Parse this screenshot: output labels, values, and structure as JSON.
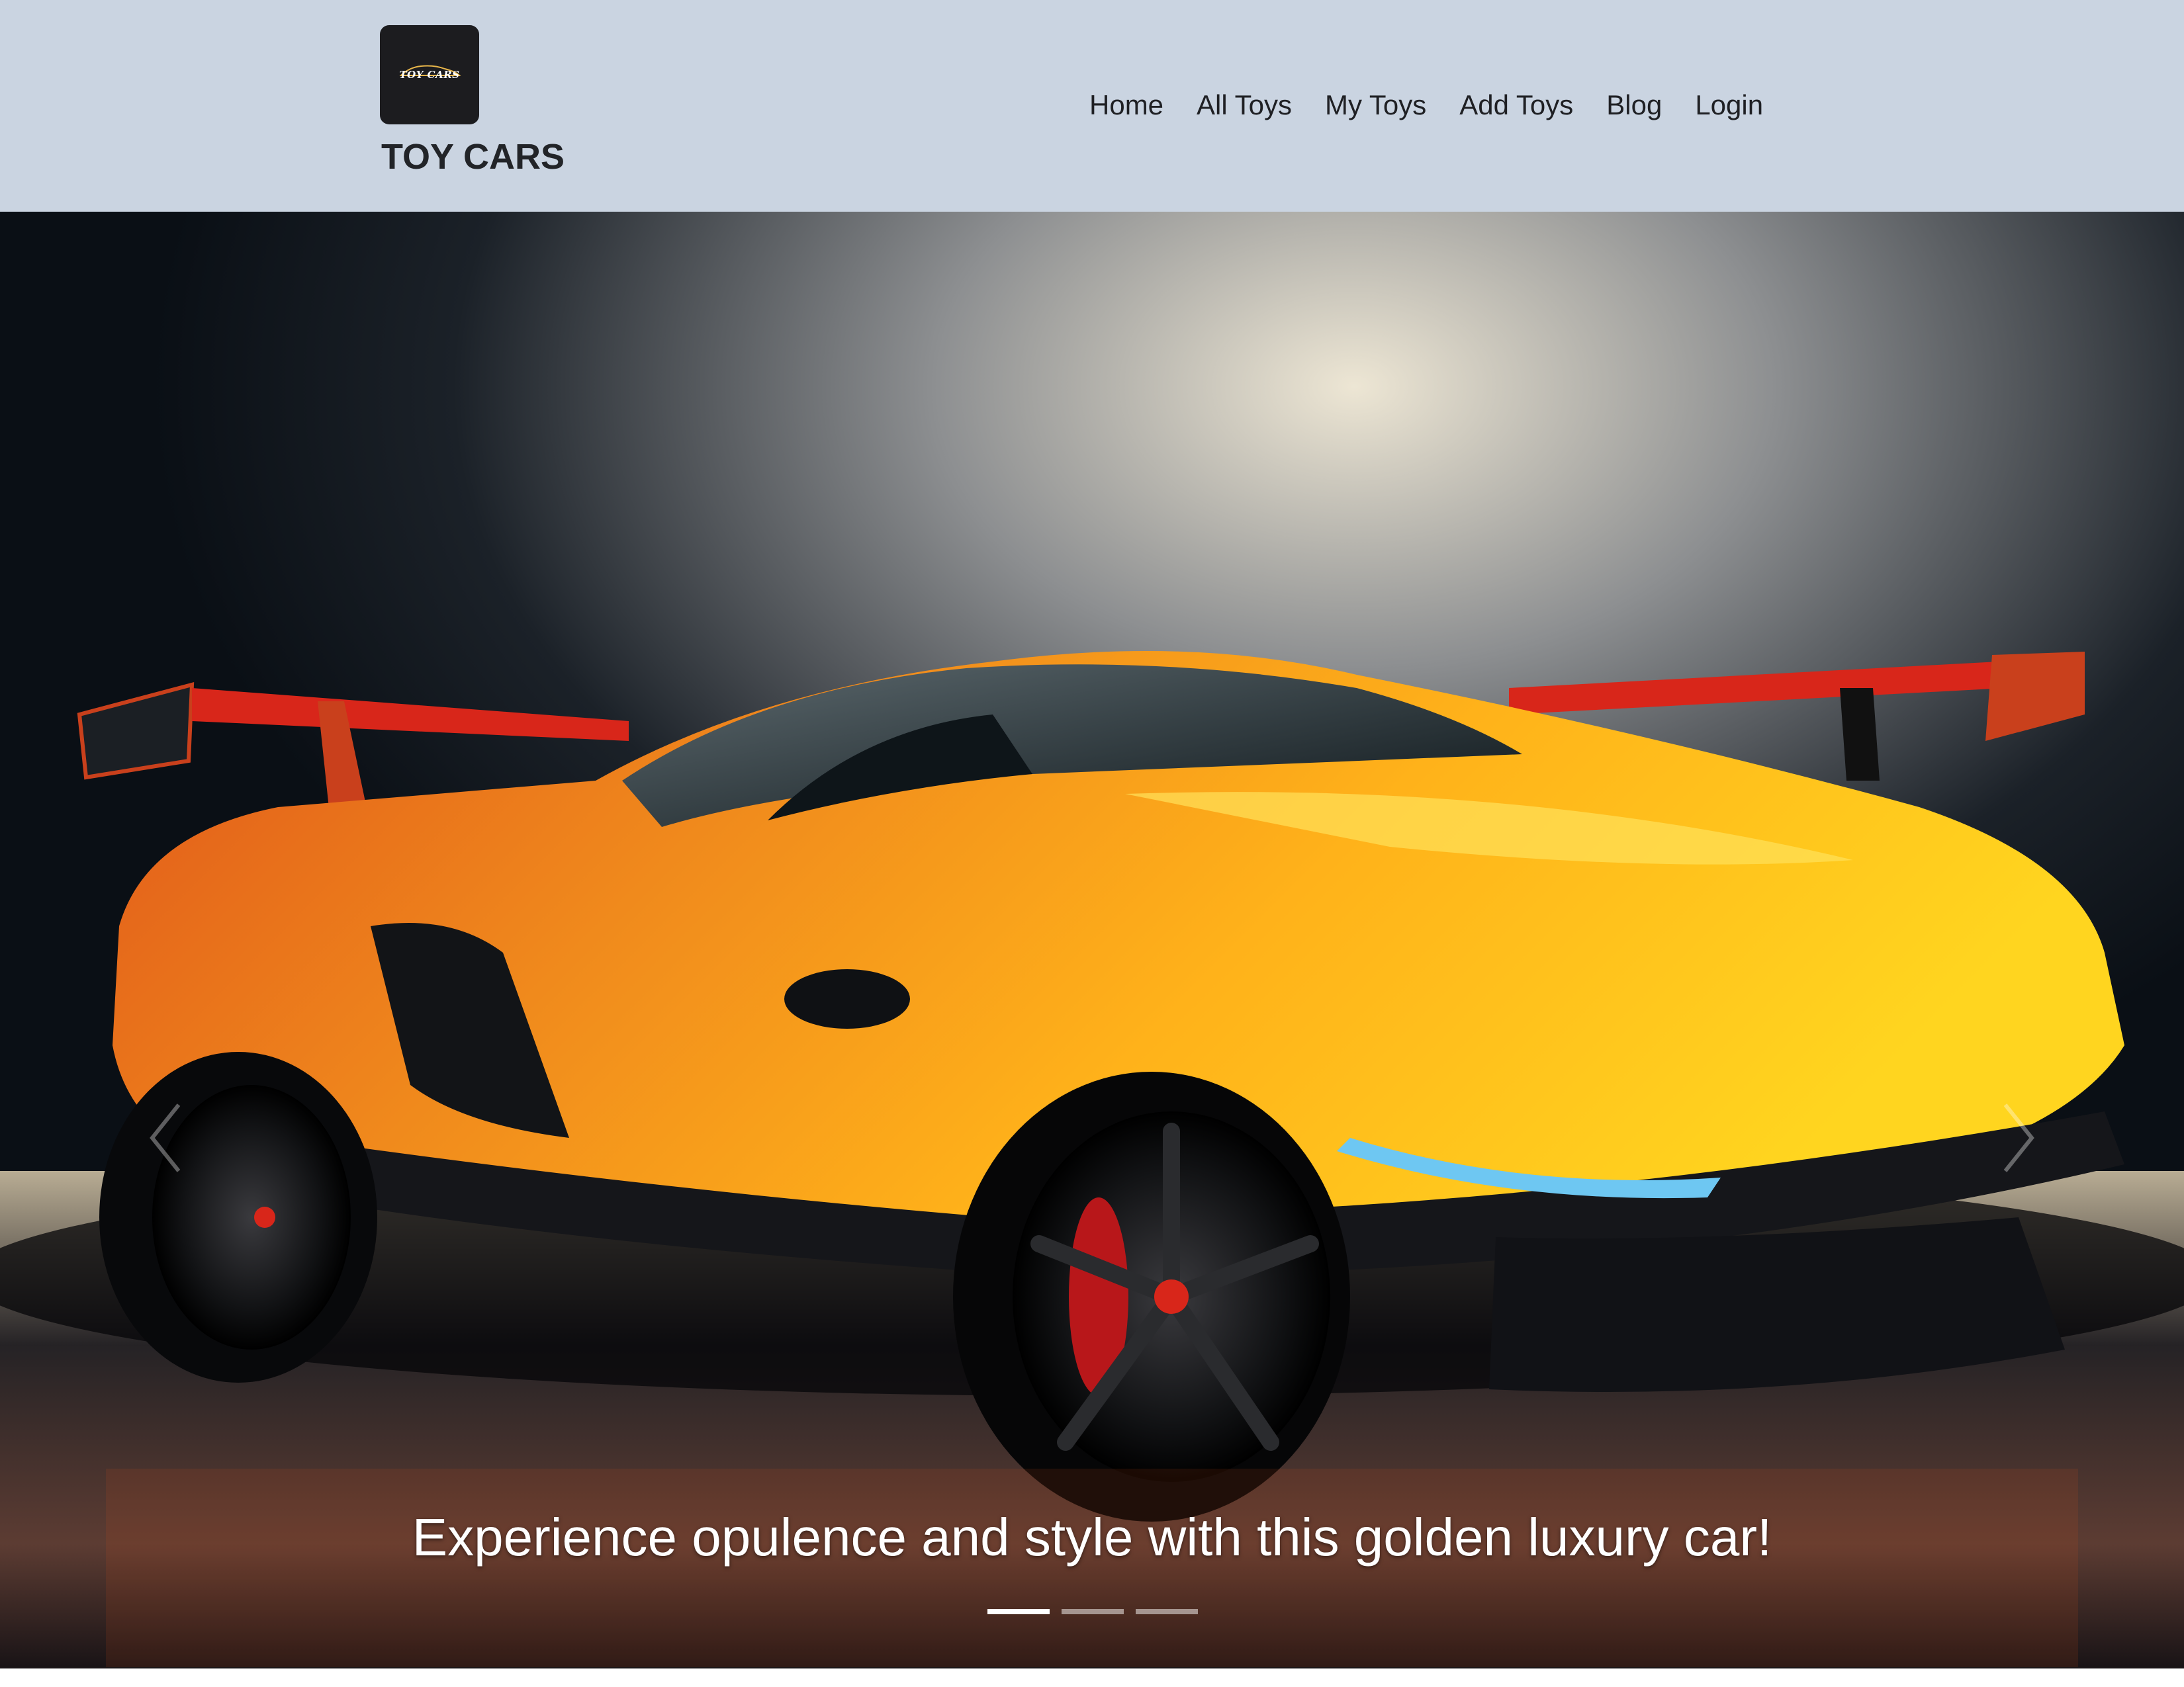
{
  "brand": {
    "logo_text": "TOY CARS",
    "name": "TOY CARS"
  },
  "nav": {
    "items": [
      {
        "label": "Home"
      },
      {
        "label": "All Toys"
      },
      {
        "label": "My Toys"
      },
      {
        "label": "Add Toys"
      },
      {
        "label": "Blog"
      },
      {
        "label": "Login"
      }
    ]
  },
  "carousel": {
    "caption": "Experience opulence and style with this golden luxury car!",
    "slide_count": 3,
    "active_index": 0,
    "prev_icon": "chevron-left-icon",
    "next_icon": "chevron-right-icon"
  },
  "colors": {
    "navbar_bg": "#cad4e1",
    "logo_bg": "#1c1c1f",
    "car_body": "#f08a1c",
    "car_highlight": "#ffcc1a",
    "accent_red": "#d8261a"
  }
}
